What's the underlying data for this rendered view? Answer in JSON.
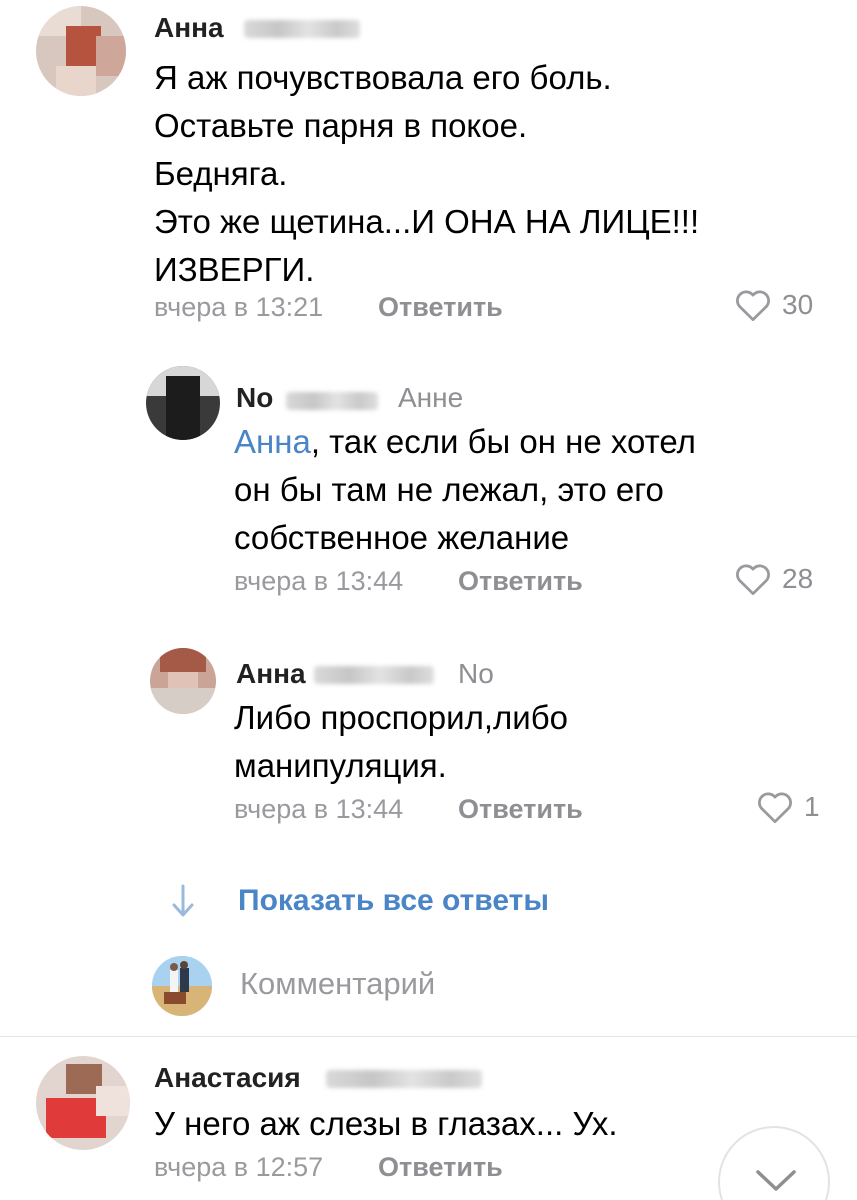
{
  "comments": [
    {
      "author": "Анна",
      "reply_to": "",
      "text_lines": [
        "Я аж почувствовала его боль.",
        "Оставьте парня в покое.",
        "Бедняга.",
        "Это же щетина...И ОНА НА ЛИЦЕ!!!",
        "ИЗВЕРГИ."
      ],
      "time": "вчера в 13:21",
      "reply_label": "Ответить",
      "likes": "30"
    },
    {
      "author": "No",
      "reply_to": "Анне",
      "mention": "Анна",
      "text_first_rest": ", так если бы он не хотел",
      "text_lines": [
        "он бы там не лежал, это его",
        "собственное желание"
      ],
      "time": "вчера в 13:44",
      "reply_label": "Ответить",
      "likes": "28"
    },
    {
      "author": "Анна",
      "reply_to": "No",
      "text_lines": [
        "Либо проспорил,либо",
        "манипуляция."
      ],
      "time": "вчера в 13:44",
      "reply_label": "Ответить",
      "likes": "1"
    },
    {
      "author": "Анастасия",
      "reply_to": "",
      "text_lines": [
        "У него аж слезы в глазах... Ух."
      ],
      "time": "вчера в 12:57",
      "reply_label": "Ответить",
      "likes": ""
    }
  ],
  "show_all_replies": "Показать все ответы",
  "composer": {
    "placeholder": "Комментарий"
  },
  "icons": {
    "like": "heart-outline-icon",
    "show_all": "arrow-down-icon",
    "scroll": "chevron-down-icon"
  },
  "colors": {
    "link": "#4a86c7",
    "meta": "#9a9a9e",
    "text": "#000000"
  }
}
